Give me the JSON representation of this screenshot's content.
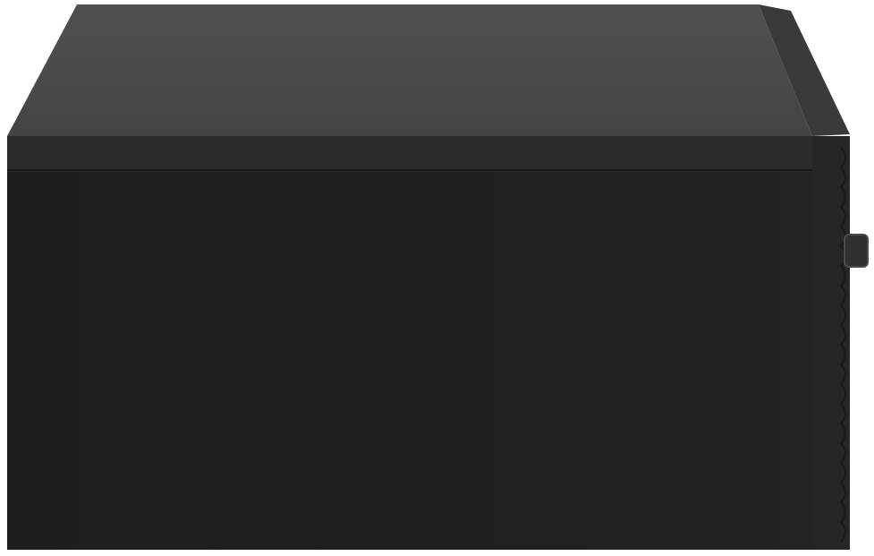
{
  "image": {
    "subject": "black-wall-mounted-drawer-side-view",
    "colors": {
      "background": "#ffffff",
      "top_surface": "#4a4a4c",
      "top_edge": "#2a2a2b",
      "front_panel": "#1f1f20",
      "side_panel": "#262627",
      "side_rear": "#3a3a3c",
      "handle": "#333335"
    }
  }
}
